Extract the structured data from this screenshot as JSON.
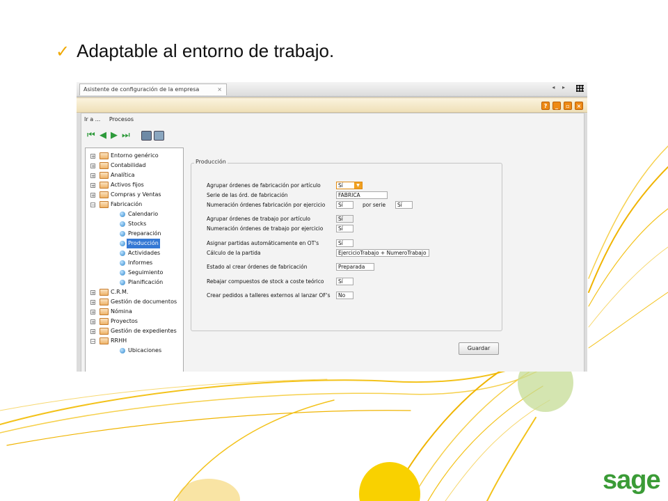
{
  "slide": {
    "check_icon": "check-icon",
    "bullet_text": "Adaptable al entorno de trabajo."
  },
  "window": {
    "tab_title": "Asistente de configuración de la empresa",
    "tab_close": "×",
    "tab_arrows": "◂ ▸",
    "controls": {
      "help": "?",
      "minimize": "_",
      "restore": "▫",
      "close": "×"
    },
    "accent_color": "#ee8a14"
  },
  "menu": {
    "items": [
      "Ir a ...",
      "Procesos"
    ]
  },
  "tree": {
    "items": [
      {
        "label": "Entorno genérico"
      },
      {
        "label": "Contabilidad"
      },
      {
        "label": "Analítica"
      },
      {
        "label": "Activos fijos"
      },
      {
        "label": "Compras y Ventas"
      },
      {
        "label": "Fabricación"
      },
      {
        "label": "Calendario"
      },
      {
        "label": "Stocks"
      },
      {
        "label": "Preparación"
      },
      {
        "label": "Producción"
      },
      {
        "label": "Actividades"
      },
      {
        "label": "Informes"
      },
      {
        "label": "Seguimiento"
      },
      {
        "label": "Planificación"
      },
      {
        "label": "C.R.M."
      },
      {
        "label": "Gestión de documentos"
      },
      {
        "label": "Nómina"
      },
      {
        "label": "Proyectos"
      },
      {
        "label": "Gestión de expedientes"
      },
      {
        "label": "RRHH"
      },
      {
        "label": "Ubicaciones"
      }
    ]
  },
  "form": {
    "group_title": "Producción",
    "rows": {
      "agrupar_of": {
        "label": "Agrupar órdenes de fabricación por artículo",
        "value": "Sí"
      },
      "serie_of": {
        "label": "Serie de las órd. de fabricación",
        "value": "FABRICA"
      },
      "numeracion_of": {
        "label": "Numeración órdenes fabricación por ejercicio",
        "value": "Sí",
        "label2": "por serie",
        "value2": "Sí"
      },
      "agrupar_ot": {
        "label": "Agrupar órdenes de trabajo por artículo",
        "value": "Sí"
      },
      "numeracion_ot": {
        "label": "Numeración órdenes de trabajo por ejercicio",
        "value": "Sí"
      },
      "asignar_partidas": {
        "label": "Asignar partidas automáticamente en OT's",
        "value": "Sí"
      },
      "calculo_partida": {
        "label": "Cálculo de la partida",
        "value": "EjercicioTrabajo + NumeroTrabajo"
      },
      "estado_of": {
        "label": "Estado al crear órdenes de fabricación",
        "value": "Preparada"
      },
      "rebajar_compuestos": {
        "label": "Rebajar compuestos de stock a coste teórico",
        "value": "Sí"
      },
      "crear_pedidos": {
        "label": "Crear pedidos a talleres externos al lanzar OF's",
        "value": "No"
      }
    },
    "save_label": "Guardar"
  },
  "brand": {
    "logo_text": "sage",
    "color": "#3a9b36"
  }
}
